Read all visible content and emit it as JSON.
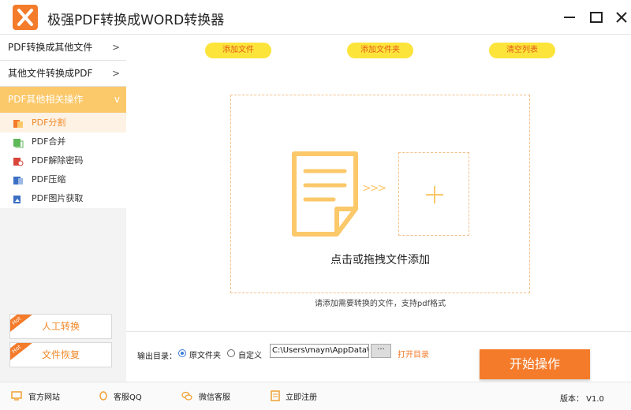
{
  "app": {
    "title": "极强PDF转换成WORD转换器"
  },
  "sidebar": {
    "categories": [
      {
        "label": "PDF转换成其他文件",
        "chevron": ">"
      },
      {
        "label": "其他文件转换成PDF",
        "chevron": ">"
      },
      {
        "label": "PDF其他相关操作",
        "chevron": "v"
      }
    ],
    "subitems": [
      {
        "label": "PDF分割",
        "icon": "pdf-split-icon"
      },
      {
        "label": "PDF合并",
        "icon": "pdf-merge-icon"
      },
      {
        "label": "PDF解除密码",
        "icon": "pdf-unlock-icon"
      },
      {
        "label": "PDF压缩",
        "icon": "pdf-compress-icon"
      },
      {
        "label": "PDF图片获取",
        "icon": "pdf-image-icon"
      }
    ],
    "hot_badge": "Hot",
    "manual_convert": "人工转换",
    "file_recovery": "文件恢复"
  },
  "toolbar": {
    "add_file": "添加文件",
    "add_folder": "添加文件夹",
    "clear_list": "清空列表"
  },
  "dropzone": {
    "label": "点击或拖拽文件添加",
    "arrows": ">>>",
    "hint": "请添加需要转换的文件，支持pdf格式"
  },
  "output": {
    "label": "输出目录：",
    "option_source": "原文件夹",
    "option_custom": "自定义",
    "selected": "原文件夹",
    "path": "C:\\Users\\mayn\\AppData\\Ro",
    "browse": "···",
    "open_dir": "打开目录",
    "start": "开始操作"
  },
  "footer": {
    "website": "官方网站",
    "qq": "客服QQ",
    "wechat": "微信客服",
    "register": "立即注册",
    "version": "版本： V1.0"
  },
  "colors": {
    "accent": "#f47b2a",
    "yellow_button": "#fde43a",
    "active_category": "#fbc86a"
  }
}
